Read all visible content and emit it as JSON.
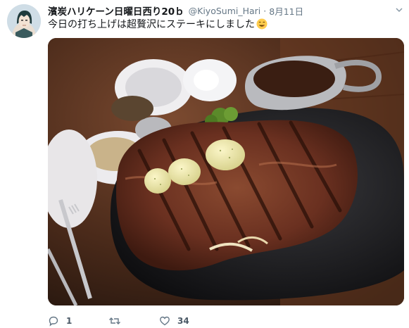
{
  "tweet": {
    "author": {
      "display_name": "濱炭ハリケーン日曜日西り20ｂ",
      "handle": "@KiyoSumi_Hari",
      "avatar_icon": "anime-avatar"
    },
    "separator": "·",
    "timestamp": "8月11日",
    "text": "今日の打ち上げは超贅沢にステーキにしました",
    "emoji": "yum-face-emoji",
    "photo_icon": "steak-on-sizzling-plate-photo",
    "actions": {
      "reply_count": "1",
      "retweet_count": "",
      "like_count": "34"
    }
  },
  "colors": {
    "text": "#14171a",
    "secondary_text": "#657786",
    "background": "#ffffff"
  }
}
